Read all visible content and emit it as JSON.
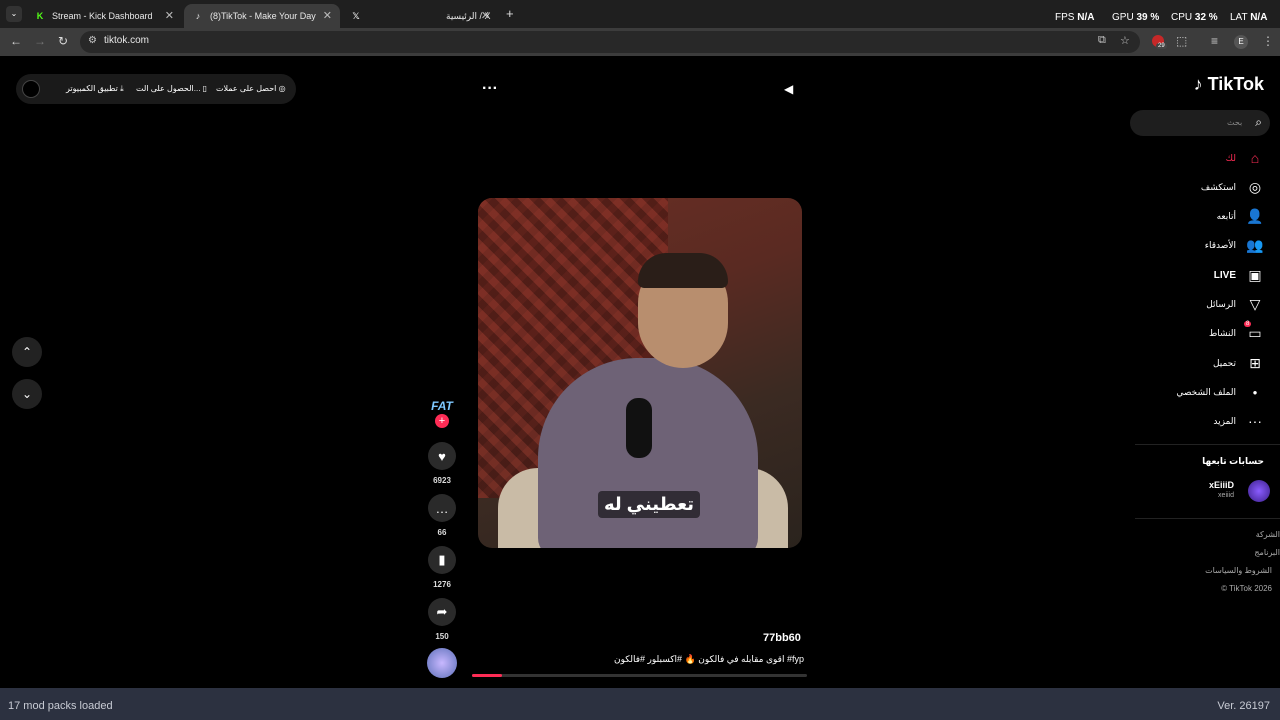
{
  "tabs": [
    {
      "title": "Stream - Kick Dashboard",
      "icon": "K"
    },
    {
      "title": "(8)TikTok - Make Your Day",
      "icon": "♪"
    },
    {
      "title": "",
      "icon": "𝕏"
    },
    {
      "title": "الرئيسية / X",
      "icon": ""
    }
  ],
  "address": {
    "url": "tiktok.com"
  },
  "overlay": {
    "fps_label": "FPS",
    "fps_value": "N/A",
    "gpu_label": "GPU",
    "gpu_value": "39 %",
    "cpu_label": "CPU",
    "cpu_value": "32 %",
    "lat_label": "LAT",
    "lat_value": "N/A"
  },
  "extension_badge": "29",
  "profile_letter": "E",
  "top_pill": {
    "desktop_app": "تطبيق الكمبيوتر",
    "get_app": "الحصول على الت...",
    "coins": "احصل على عملات"
  },
  "logo": "TikTok",
  "search": {
    "placeholder": "بحث"
  },
  "sidebar": {
    "items": [
      {
        "label": "لك",
        "icon": "home-icon"
      },
      {
        "label": "استكشف",
        "icon": "compass-icon"
      },
      {
        "label": "أتابعه",
        "icon": "user-follow-icon"
      },
      {
        "label": "الأصدقاء",
        "icon": "friends-icon"
      },
      {
        "label": "LIVE",
        "icon": "live-icon"
      },
      {
        "label": "الرسائل",
        "icon": "send-icon"
      },
      {
        "label": "النشاط",
        "icon": "activity-icon"
      },
      {
        "label": "تحميل",
        "icon": "upload-icon"
      },
      {
        "label": "الملف الشخصي",
        "icon": "profile-icon"
      },
      {
        "label": "المزيد",
        "icon": "more-icon"
      }
    ],
    "activity_badge": "8",
    "following_title": "حسابات تابعها",
    "following_account": {
      "name": "xEiiiD",
      "handle": "xeiiid"
    },
    "footer": [
      "الشركة",
      "البرنامج",
      "الشروط والسياسات",
      "© TikTok 2026"
    ]
  },
  "video": {
    "caption": "تعطيني له",
    "username": "77bb60",
    "description": "اقوى مقابله في فالكون 🔥 #اكسبلور #فالكون #fyp",
    "progress": 0.09
  },
  "actions": {
    "avatar_label": "FAT",
    "likes": "6923",
    "comments": "66",
    "saves": "1276",
    "shares": "150"
  },
  "statusbar": {
    "left": "17 mod packs loaded",
    "right": "Ver. 26197"
  },
  "colors": {
    "accent": "#fe2c55",
    "background": "#000000"
  }
}
